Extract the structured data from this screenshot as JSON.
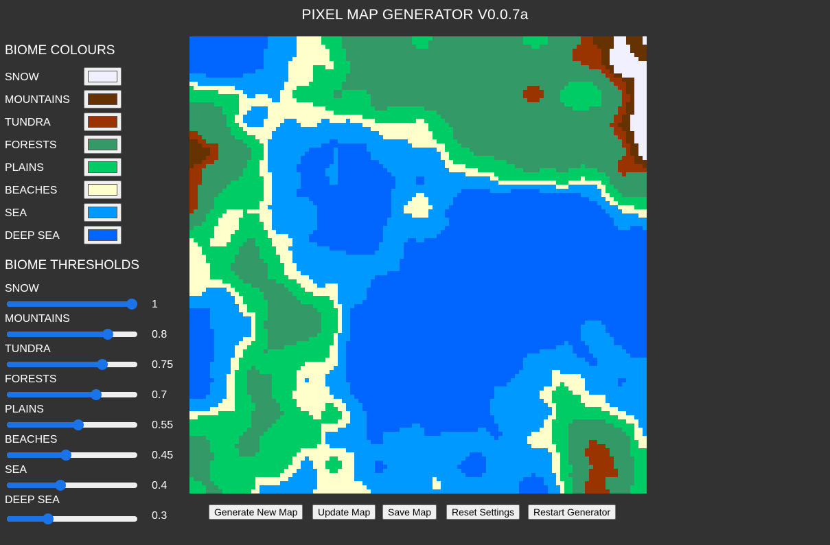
{
  "title": "PIXEL MAP GENERATOR V0.0.7a",
  "biome_colours": {
    "heading": "BIOME COLOURS",
    "items": [
      {
        "label": "SNOW",
        "color": "#f0f0ff"
      },
      {
        "label": "MOUNTAINS",
        "color": "#663300"
      },
      {
        "label": "TUNDRA",
        "color": "#993300"
      },
      {
        "label": "FORESTS",
        "color": "#339966"
      },
      {
        "label": "PLAINS",
        "color": "#00cc66"
      },
      {
        "label": "BEACHES",
        "color": "#ffffcc"
      },
      {
        "label": "SEA",
        "color": "#0099ff"
      },
      {
        "label": "DEEP SEA",
        "color": "#0066ff"
      }
    ]
  },
  "biome_thresholds": {
    "heading": "BIOME THRESHOLDS",
    "items": [
      {
        "label": "SNOW",
        "value": "1"
      },
      {
        "label": "MOUNTAINS",
        "value": "0.8"
      },
      {
        "label": "TUNDRA",
        "value": "0.75"
      },
      {
        "label": "FORESTS",
        "value": "0.7"
      },
      {
        "label": "PLAINS",
        "value": "0.55"
      },
      {
        "label": "BEACHES",
        "value": "0.45"
      },
      {
        "label": "SEA",
        "value": "0.4"
      },
      {
        "label": "DEEP SEA",
        "value": "0.3"
      }
    ]
  },
  "buttons": {
    "generate": "Generate New Map",
    "update": "Update Map",
    "save": "Save Map",
    "reset": "Reset Settings",
    "restart": "Restart Generator"
  }
}
